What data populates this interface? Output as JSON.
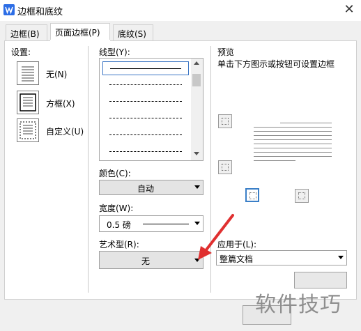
{
  "window": {
    "title": "边框和底纹",
    "close_glyph": "✕"
  },
  "tabs": [
    {
      "label": "边框(B)"
    },
    {
      "label": "页面边框(P)"
    },
    {
      "label": "底纹(S)"
    }
  ],
  "settings": {
    "heading": "设置:",
    "options": [
      {
        "label": "无(N)"
      },
      {
        "label": "方框(X)"
      },
      {
        "label": "自定义(U)"
      }
    ]
  },
  "line_style": {
    "label": "线型(Y):"
  },
  "color": {
    "label": "颜色(C):",
    "value": "自动"
  },
  "width": {
    "label": "宽度(W):",
    "value": "0.5 磅"
  },
  "art": {
    "label": "艺术型(R):",
    "value": "无"
  },
  "preview": {
    "heading": "预览",
    "hint": "单击下方图示或按钮可设置边框"
  },
  "apply_to": {
    "label": "应用于(L):",
    "value": "整篇文档"
  },
  "watermark": "软件技巧",
  "colors": {
    "accent": "#3b75c4",
    "arrow": "#e03030",
    "app_icon": "#2d6ee6"
  }
}
